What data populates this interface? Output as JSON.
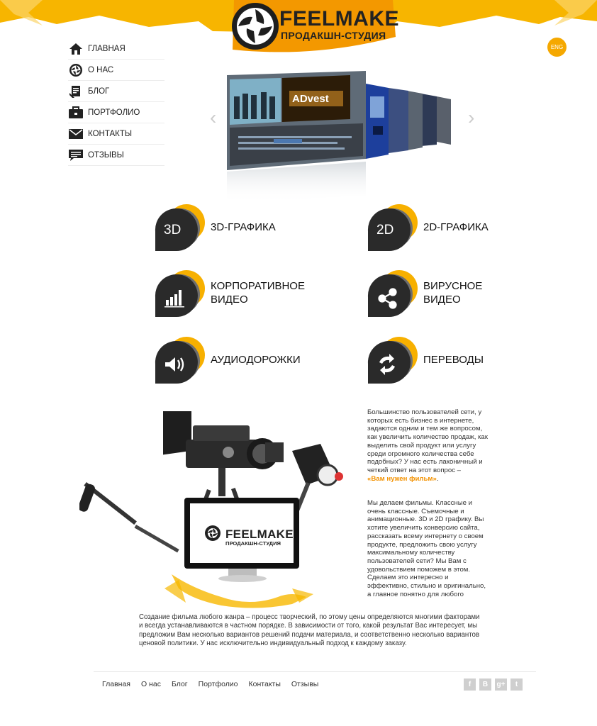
{
  "header": {
    "brand": "FEELMAKE",
    "brand_sub": "ПРОДАКШН-СТУДИЯ",
    "lang_button": "ENG",
    "accent": "#f5a800"
  },
  "nav": {
    "items": [
      {
        "label": "ГЛАВНАЯ",
        "icon": "home-icon"
      },
      {
        "label": "О НАС",
        "icon": "aperture-icon"
      },
      {
        "label": "БЛОГ",
        "icon": "blog-icon"
      },
      {
        "label": "ПОРТФОЛИО",
        "icon": "briefcase-icon"
      },
      {
        "label": "КОНТАКТЫ",
        "icon": "envelope-icon"
      },
      {
        "label": "ОТЗЫВЫ",
        "icon": "speech-bubble-icon"
      }
    ]
  },
  "slider": {
    "prev": "‹",
    "next": "›",
    "slide_text": "ADvest"
  },
  "services": {
    "s3d": {
      "icon_text": "3D",
      "label": "3D-ГРАФИКА"
    },
    "s2d": {
      "icon_text": "2D",
      "label": "2D-ГРАФИКА"
    },
    "corp": {
      "line1": "КОРПОРАТИВНОЕ",
      "line2": "ВИДЕО",
      "icon": "bar-chart-icon"
    },
    "viral": {
      "line1": "ВИРУСНОЕ",
      "line2": "ВИДЕО",
      "icon": "share-icon"
    },
    "audio": {
      "label": "АУДИОДОРОЖКИ",
      "icon": "speaker-icon"
    },
    "trans": {
      "label": "ПЕРЕВОДЫ",
      "icon": "refresh-icon"
    }
  },
  "promo": {
    "monitor_brand": "FEELMAKE",
    "monitor_sub": "ПРОДАКШН-СТУДИЯ",
    "para1": [
      "Большинство пользователей сети, у",
      "которых есть бизнес в интернете,",
      "задаются одним и тем же вопросом,",
      "как увеличить количество продаж, как",
      "выделить свой продукт или услугу",
      "среди огромного количества себе",
      "подобных? У нас есть лаконичный и",
      "четкий ответ на этот вопрос –"
    ],
    "highlight": "«Вам нужен фильм»",
    "highlight_end": ".",
    "para2": [
      "Мы делаем фильмы. Классные и",
      "очень классные. Съемочные и",
      "анимационные. 3D и 2D графику. Вы",
      "хотите увеличить конверсию сайта,",
      "рассказать всему интернету о своем",
      "продукте, предложить свою услугу",
      "максимальному количеству",
      "пользователей сети? Мы Вам с",
      "удовольствием поможем в этом.",
      "Сделаем это интересно и",
      "эффективно, стильно и оригинально,",
      "а главное понятно для любого"
    ],
    "bottom": [
      "Создание фильма любого жанра – процесс творческий, по этому цены определяются многими факторами",
      "и всегда устанавливаются в частном порядке. В зависимости от того, какой результат Вас интересует, мы",
      "предложим Вам несколько вариантов решений подачи материала, и соответственно несколько вариантов",
      "ценовой политики. У нас исключительно индивидуальный подход к каждому заказу."
    ]
  },
  "footer": {
    "links": [
      "Главная",
      "О нас",
      "Блог",
      "Портфолио",
      "Контакты",
      "Отзывы"
    ],
    "social": [
      {
        "icon": "facebook-icon",
        "glyph": "f"
      },
      {
        "icon": "vkontakte-icon",
        "glyph": "В"
      },
      {
        "icon": "google-plus-icon",
        "glyph": "g+"
      },
      {
        "icon": "twitter-icon",
        "glyph": "t"
      }
    ]
  }
}
